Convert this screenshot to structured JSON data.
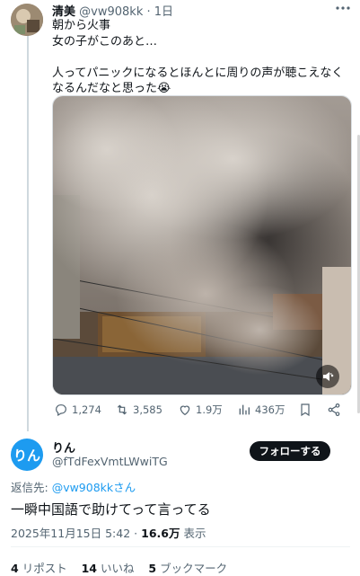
{
  "tweet": {
    "author_name": "清美",
    "author_handle": "@vw908kk",
    "separator": "·",
    "time_ago": "1日",
    "text": "朝から火事\n女の子がこのあと…\n\n人ってパニックになるとほんとに周りの声が聴こえなくなるんだなと思った😭",
    "metrics": {
      "replies": "1,274",
      "reposts": "3,585",
      "likes": "1.9万",
      "views": "436万"
    }
  },
  "reply": {
    "avatar_text": "りん",
    "author_name": "りん",
    "author_handle": "@fTdFexVmtLWwiTG",
    "follow_label": "フォローする",
    "reply_to_label": "返信先: ",
    "reply_to_handle": "@vw908kkさん",
    "text": "一瞬中国語で助けてって言ってる",
    "date": "2025年11月15日 5:42",
    "separator": "·",
    "views_count": "16.6万",
    "views_label": "表示",
    "reposts_count": "4",
    "reposts_label": "リポスト",
    "likes_count": "14",
    "likes_label": "いいね",
    "bookmarks_count": "5",
    "bookmarks_label": "ブックマーク"
  },
  "colors": {
    "accent": "#1d9bf0",
    "text_primary": "#0f1419",
    "text_secondary": "#536471"
  },
  "icons": [
    "more-icon",
    "volume-icon",
    "reply-icon",
    "repost-icon",
    "like-icon",
    "views-icon",
    "bookmark-icon",
    "share-icon"
  ]
}
